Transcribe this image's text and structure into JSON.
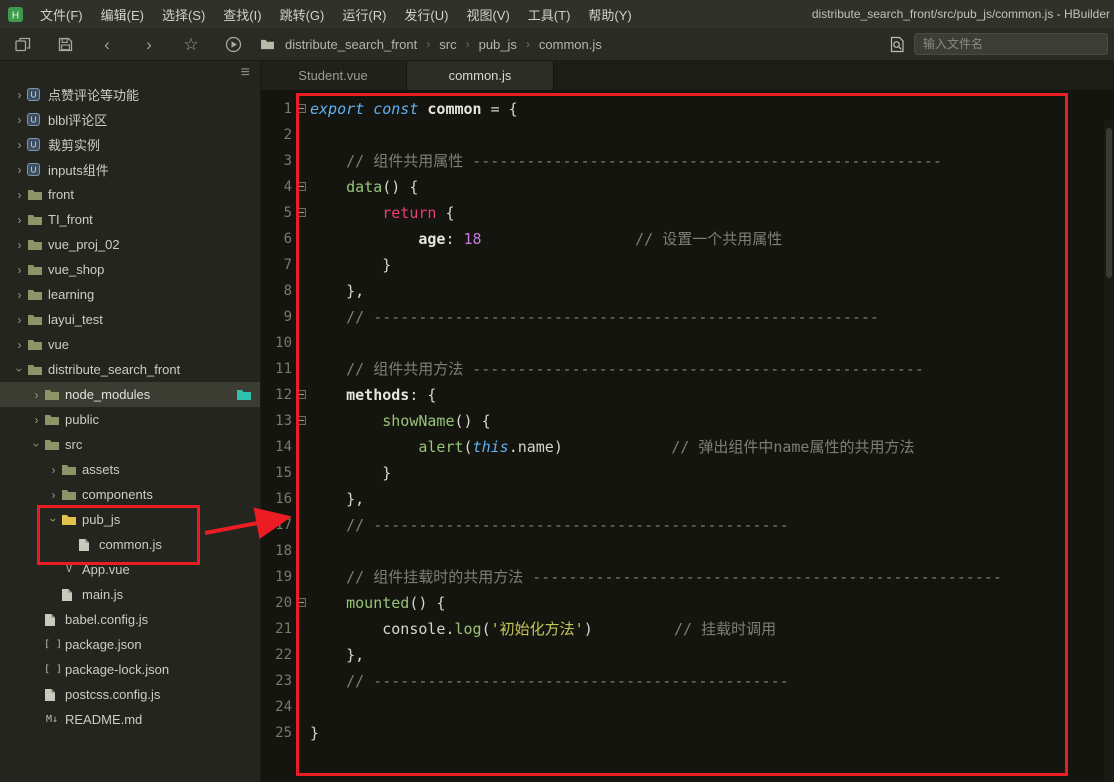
{
  "window": {
    "title": "distribute_search_front/src/pub_js/common.js - HBuilder"
  },
  "menubar": {
    "items": [
      "文件(F)",
      "编辑(E)",
      "选择(S)",
      "查找(I)",
      "跳转(G)",
      "运行(R)",
      "发行(U)",
      "视图(V)",
      "工具(T)",
      "帮助(Y)"
    ]
  },
  "toolbar": {
    "breadcrumb": [
      "distribute_search_front",
      "src",
      "pub_js",
      "common.js"
    ],
    "search_placeholder": "输入文件名"
  },
  "icons": {
    "hamburger": "≡",
    "back": "‹",
    "forward": "›",
    "star": "☆",
    "crumb_sep": "›",
    "tree_arrow": "›"
  },
  "sidebar": {
    "items": [
      {
        "label": "点赞评论等功能",
        "level": 0,
        "arrow": "collapsed",
        "icon": "app"
      },
      {
        "label": "blbl评论区",
        "level": 0,
        "arrow": "collapsed",
        "icon": "app"
      },
      {
        "label": "裁剪实例",
        "level": 0,
        "arrow": "collapsed",
        "icon": "app"
      },
      {
        "label": "inputs组件",
        "level": 0,
        "arrow": "collapsed",
        "icon": "app"
      },
      {
        "label": "front",
        "level": 0,
        "arrow": "collapsed",
        "icon": "folder"
      },
      {
        "label": "TI_front",
        "level": 0,
        "arrow": "collapsed",
        "icon": "folder"
      },
      {
        "label": "vue_proj_02",
        "level": 0,
        "arrow": "collapsed",
        "icon": "folder"
      },
      {
        "label": "vue_shop",
        "level": 0,
        "arrow": "collapsed",
        "icon": "folder"
      },
      {
        "label": "learning",
        "level": 0,
        "arrow": "collapsed",
        "icon": "folder"
      },
      {
        "label": "layui_test",
        "level": 0,
        "arrow": "collapsed",
        "icon": "folder"
      },
      {
        "label": "vue",
        "level": 0,
        "arrow": "collapsed",
        "icon": "folder"
      },
      {
        "label": "distribute_search_front",
        "level": 0,
        "arrow": "expanded",
        "icon": "folder"
      },
      {
        "label": "node_modules",
        "level": 1,
        "arrow": "collapsed",
        "icon": "folder",
        "selected": true,
        "trailing": true
      },
      {
        "label": "public",
        "level": 1,
        "arrow": "collapsed",
        "icon": "folder"
      },
      {
        "label": "src",
        "level": 1,
        "arrow": "expanded",
        "icon": "folder"
      },
      {
        "label": "assets",
        "level": 2,
        "arrow": "collapsed",
        "icon": "folder"
      },
      {
        "label": "components",
        "level": 2,
        "arrow": "collapsed",
        "icon": "folder"
      },
      {
        "label": "pub_js",
        "level": 2,
        "arrow": "expanded",
        "icon": "folder",
        "icon_color": "#e3c24b"
      },
      {
        "label": "common.js",
        "level": 3,
        "icon": "doc"
      },
      {
        "label": "App.vue",
        "level": 2,
        "icon": "vue"
      },
      {
        "label": "main.js",
        "level": 2,
        "icon": "doc"
      },
      {
        "label": "babel.config.js",
        "level": 1,
        "icon": "doc"
      },
      {
        "label": "package.json",
        "level": 1,
        "icon": "json"
      },
      {
        "label": "package-lock.json",
        "level": 1,
        "icon": "json"
      },
      {
        "label": "postcss.config.js",
        "level": 1,
        "icon": "doc"
      },
      {
        "label": "README.md",
        "level": 1,
        "icon": "md"
      }
    ]
  },
  "tabs": [
    {
      "label": "Student.vue",
      "active": false
    },
    {
      "label": "common.js",
      "active": true
    }
  ],
  "editor": {
    "lines": [
      {
        "n": 1,
        "fold": true,
        "t": [
          [
            "kw",
            "export "
          ],
          [
            "kw",
            "const "
          ],
          [
            "idb",
            "common"
          ],
          [
            "pln",
            " = {"
          ]
        ]
      },
      {
        "n": 2,
        "t": []
      },
      {
        "n": 3,
        "t": [
          [
            "pln",
            "    "
          ],
          [
            "com",
            "// 组件共用属性 ----------------------------------------------------"
          ]
        ]
      },
      {
        "n": 4,
        "fold": true,
        "t": [
          [
            "pln",
            "    "
          ],
          [
            "fn",
            "data"
          ],
          [
            "pln",
            "() {"
          ]
        ]
      },
      {
        "n": 5,
        "fold": true,
        "t": [
          [
            "pln",
            "        "
          ],
          [
            "ret",
            "return"
          ],
          [
            "pln",
            " {"
          ]
        ]
      },
      {
        "n": 6,
        "t": [
          [
            "pln",
            "            "
          ],
          [
            "prop",
            "age"
          ],
          [
            "pln",
            ": "
          ],
          [
            "num",
            "18"
          ],
          [
            "pln",
            "                 "
          ],
          [
            "com",
            "// 设置一个共用属性"
          ]
        ]
      },
      {
        "n": 7,
        "t": [
          [
            "pln",
            "        }"
          ]
        ]
      },
      {
        "n": 8,
        "t": [
          [
            "pln",
            "    },"
          ]
        ]
      },
      {
        "n": 9,
        "t": [
          [
            "pln",
            "    "
          ],
          [
            "com",
            "// --------------------------------------------------------"
          ]
        ]
      },
      {
        "n": 10,
        "t": []
      },
      {
        "n": 11,
        "t": [
          [
            "pln",
            "    "
          ],
          [
            "com",
            "// 组件共用方法 --------------------------------------------------"
          ]
        ]
      },
      {
        "n": 12,
        "fold": true,
        "t": [
          [
            "pln",
            "    "
          ],
          [
            "prop",
            "methods"
          ],
          [
            "pln",
            ": {"
          ]
        ]
      },
      {
        "n": 13,
        "fold": true,
        "t": [
          [
            "pln",
            "        "
          ],
          [
            "fn",
            "showName"
          ],
          [
            "pln",
            "() {"
          ]
        ]
      },
      {
        "n": 14,
        "t": [
          [
            "pln",
            "            "
          ],
          [
            "fn",
            "alert"
          ],
          [
            "pln",
            "("
          ],
          [
            "kw",
            "this"
          ],
          [
            "pln",
            ".name)"
          ],
          [
            "pln",
            "            "
          ],
          [
            "com",
            "// 弹出组件中name属性的共用方法"
          ]
        ]
      },
      {
        "n": 15,
        "t": [
          [
            "pln",
            "        }"
          ]
        ]
      },
      {
        "n": 16,
        "t": [
          [
            "pln",
            "    },"
          ]
        ]
      },
      {
        "n": 17,
        "t": [
          [
            "pln",
            "    "
          ],
          [
            "com",
            "// ----------------------------------------------"
          ]
        ]
      },
      {
        "n": 18,
        "t": []
      },
      {
        "n": 19,
        "t": [
          [
            "pln",
            "    "
          ],
          [
            "com",
            "// 组件挂载时的共用方法 ----------------------------------------------------"
          ]
        ]
      },
      {
        "n": 20,
        "fold": true,
        "t": [
          [
            "pln",
            "    "
          ],
          [
            "fn",
            "mounted"
          ],
          [
            "pln",
            "() {"
          ]
        ]
      },
      {
        "n": 21,
        "t": [
          [
            "pln",
            "        console."
          ],
          [
            "fn",
            "log"
          ],
          [
            "pln",
            "("
          ],
          [
            "str",
            "'初始化方法'"
          ],
          [
            "pln",
            ")"
          ],
          [
            "pln",
            "         "
          ],
          [
            "com",
            "// 挂载时调用"
          ]
        ]
      },
      {
        "n": 22,
        "t": [
          [
            "pln",
            "    },"
          ]
        ]
      },
      {
        "n": 23,
        "t": [
          [
            "pln",
            "    "
          ],
          [
            "com",
            "// ----------------------------------------------"
          ]
        ]
      },
      {
        "n": 24,
        "t": []
      },
      {
        "n": 25,
        "t": [
          [
            "pln",
            "}"
          ]
        ]
      }
    ]
  },
  "annotations": {
    "color": "#ec1c24"
  }
}
